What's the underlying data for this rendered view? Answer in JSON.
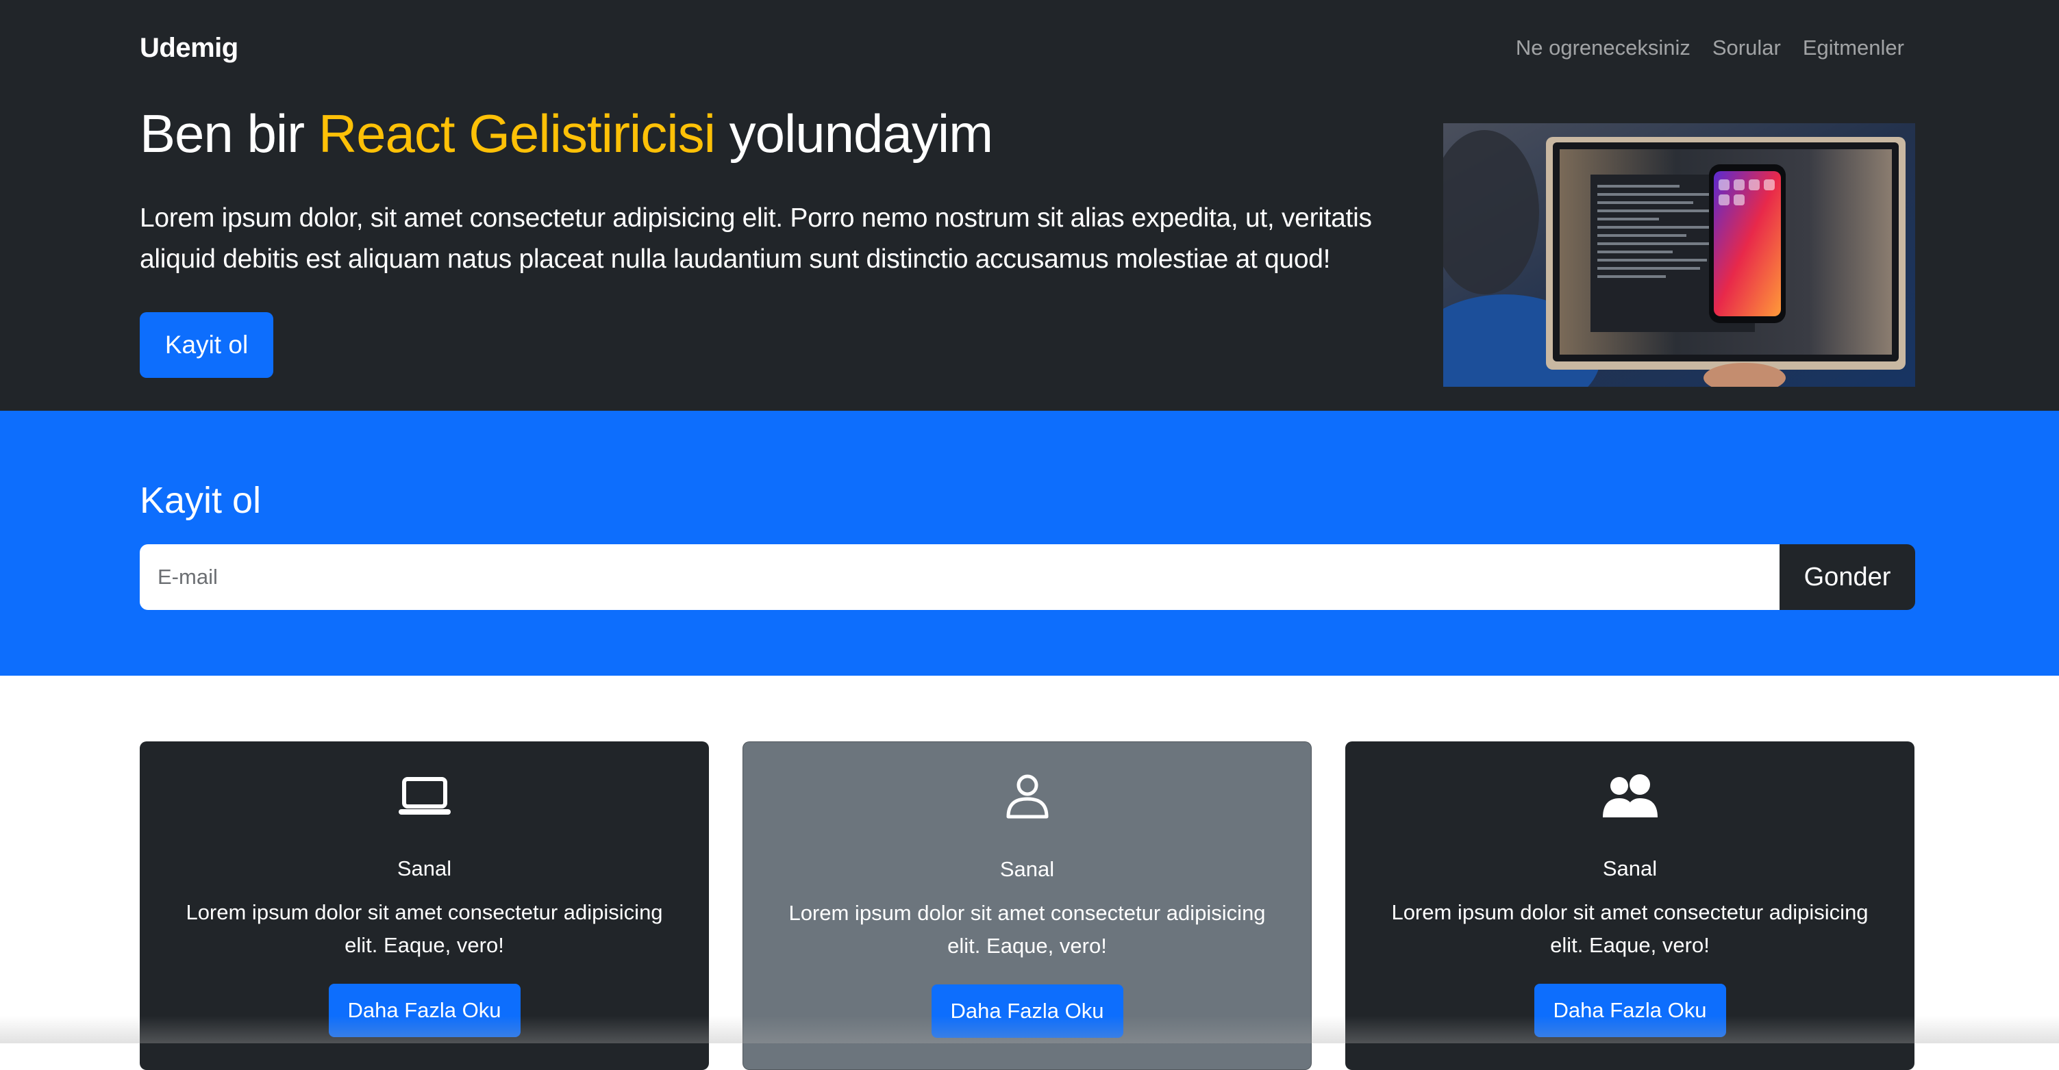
{
  "nav": {
    "brand": "Udemig",
    "links": [
      "Ne ogreneceksiniz",
      "Sorular",
      "Egitmenler"
    ]
  },
  "hero": {
    "title_before": "Ben bir ",
    "title_accent": "React Gelistiricisi",
    "title_after": " yolundayim",
    "text": "Lorem ipsum dolor, sit amet consectetur adipisicing elit. Porro nemo nostrum sit alias expedita, ut, veritatis aliquid debitis est aliquam natus placeat nulla laudantium sunt distinctio accusamus molestiae at quod!",
    "button_label": "Kayit ol",
    "image_icon": "laptop-phone-photo"
  },
  "signup": {
    "title": "Kayit ol",
    "input_placeholder": "E-mail",
    "input_value": "",
    "button_label": "Gonder"
  },
  "cards": [
    {
      "icon": "laptop-icon",
      "title": "Sanal",
      "text": "Lorem ipsum dolor sit amet consectetur adipisicing elit. Eaque, vero!",
      "button_label": "Daha Fazla Oku"
    },
    {
      "icon": "person-icon",
      "title": "Sanal",
      "text": "Lorem ipsum dolor sit amet consectetur adipisicing elit. Eaque, vero!",
      "button_label": "Daha Fazla Oku"
    },
    {
      "icon": "people-icon",
      "title": "Sanal",
      "text": "Lorem ipsum dolor sit amet consectetur adipisicing elit. Eaque, vero!",
      "button_label": "Daha Fazla Oku"
    }
  ],
  "colors": {
    "dark": "#212529",
    "primary": "#0d6efd",
    "accent": "#ffc107",
    "gray": "#6c757d"
  }
}
